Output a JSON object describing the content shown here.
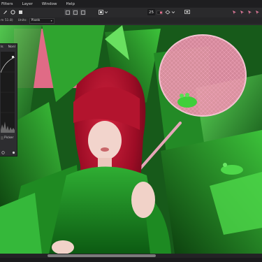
{
  "menu": {
    "items": [
      "Filters",
      "Layer",
      "Window",
      "Help"
    ]
  },
  "toolbar": {
    "zoom_value": "25"
  },
  "context_bar": {
    "partial_label": "m 51.8)",
    "units_label": "Units:",
    "units_value": "Pixels"
  },
  "adjust_panel": {
    "tab_1": "ls",
    "tab_2": "Nonl",
    "picker_label": "Picker"
  },
  "colors": {
    "accent_pink": "#e26f8d",
    "canvas_green": "#1d7a22",
    "hair_red": "#a00f2a",
    "ui_dark": "#2b2b2d"
  },
  "icons": [
    "brush-icon",
    "layer-stack-icon",
    "grid-icon",
    "arrow-icon",
    "eye-icon",
    "snapping-icon"
  ]
}
